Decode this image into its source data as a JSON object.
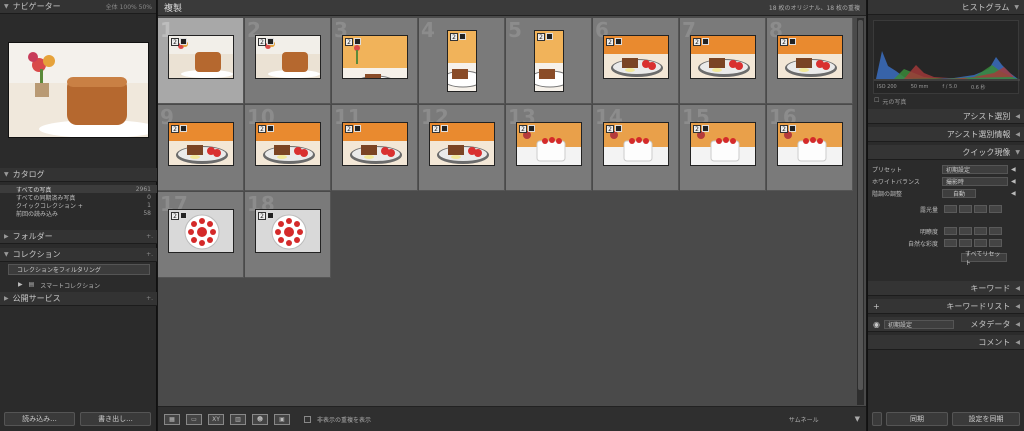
{
  "left_panel": {
    "navigator": {
      "title": "ナビゲーター",
      "opts": [
        "全体",
        "100%",
        "50%"
      ]
    },
    "catalog": {
      "title": "カタログ",
      "items": [
        {
          "label": "すべての写真",
          "count": "2961"
        },
        {
          "label": "すべての同期済み写真",
          "count": "0"
        },
        {
          "label": "クイックコレクション +",
          "count": "1"
        },
        {
          "label": "前回の読み込み",
          "count": "58"
        }
      ]
    },
    "folders": {
      "title": "フォルダー"
    },
    "collections": {
      "title": "コレクション",
      "filter": "コレクションをフィルタリング",
      "smart": "スマートコレクション"
    },
    "publish": {
      "title": "公開サービス"
    },
    "import_label": "読み込み...",
    "export_label": "書き出し..."
  },
  "center": {
    "title": "複製",
    "info": "18 枚のオリジナル、18 枚の重複",
    "cells": [
      {
        "num": "1",
        "w": 66,
        "h": 44,
        "scene": "cake"
      },
      {
        "num": "2",
        "w": 66,
        "h": 44,
        "scene": "cake"
      },
      {
        "num": "3",
        "w": 66,
        "h": 44,
        "scene": "slice"
      },
      {
        "num": "4",
        "w": 30,
        "h": 62,
        "scene": "slice"
      },
      {
        "num": "5",
        "w": 30,
        "h": 62,
        "scene": "slice"
      },
      {
        "num": "6",
        "w": 66,
        "h": 44,
        "scene": "plate"
      },
      {
        "num": "7",
        "w": 66,
        "h": 44,
        "scene": "plate"
      },
      {
        "num": "8",
        "w": 66,
        "h": 44,
        "scene": "plate"
      },
      {
        "num": "9",
        "w": 66,
        "h": 44,
        "scene": "plate"
      },
      {
        "num": "10",
        "w": 66,
        "h": 44,
        "scene": "plate"
      },
      {
        "num": "11",
        "w": 66,
        "h": 44,
        "scene": "plate"
      },
      {
        "num": "12",
        "w": 66,
        "h": 44,
        "scene": "plate"
      },
      {
        "num": "13",
        "w": 66,
        "h": 44,
        "scene": "white"
      },
      {
        "num": "14",
        "w": 66,
        "h": 44,
        "scene": "white"
      },
      {
        "num": "15",
        "w": 66,
        "h": 44,
        "scene": "white"
      },
      {
        "num": "16",
        "w": 66,
        "h": 44,
        "scene": "white"
      },
      {
        "num": "17",
        "w": 66,
        "h": 44,
        "scene": "top"
      },
      {
        "num": "18",
        "w": 66,
        "h": 44,
        "scene": "top"
      }
    ],
    "badge": "2",
    "show_hidden": "非表示の重複を表示",
    "thumb_label": "サムネール"
  },
  "right_panel": {
    "histogram": {
      "title": "ヒストグラム",
      "iso": "ISO 200",
      "focal": "50 mm",
      "aperture": "f / 5.0",
      "shutter": "0.6 秒",
      "original": "元の写真"
    },
    "sections": [
      "アシスト選別",
      "アシスト選別情報"
    ],
    "quick_develop": {
      "title": "クイック現像",
      "preset_label": "プリセット",
      "preset_value": "初期設定",
      "wb_label": "ホワイトバランス",
      "wb_value": "撮影時",
      "tone_label": "階調の調整",
      "tone_btn": "自動",
      "exposure": "露光量",
      "clarity": "明瞭度",
      "vibrance": "自然な彩度",
      "reset": "すべてリセット"
    },
    "keyword": "キーワード",
    "keyword_list": "キーワードリスト",
    "metadata": {
      "title": "メタデータ",
      "value": "初期設定"
    },
    "comment": "コメント",
    "sync_label": "同期",
    "sync_settings_label": "設定を同期"
  }
}
